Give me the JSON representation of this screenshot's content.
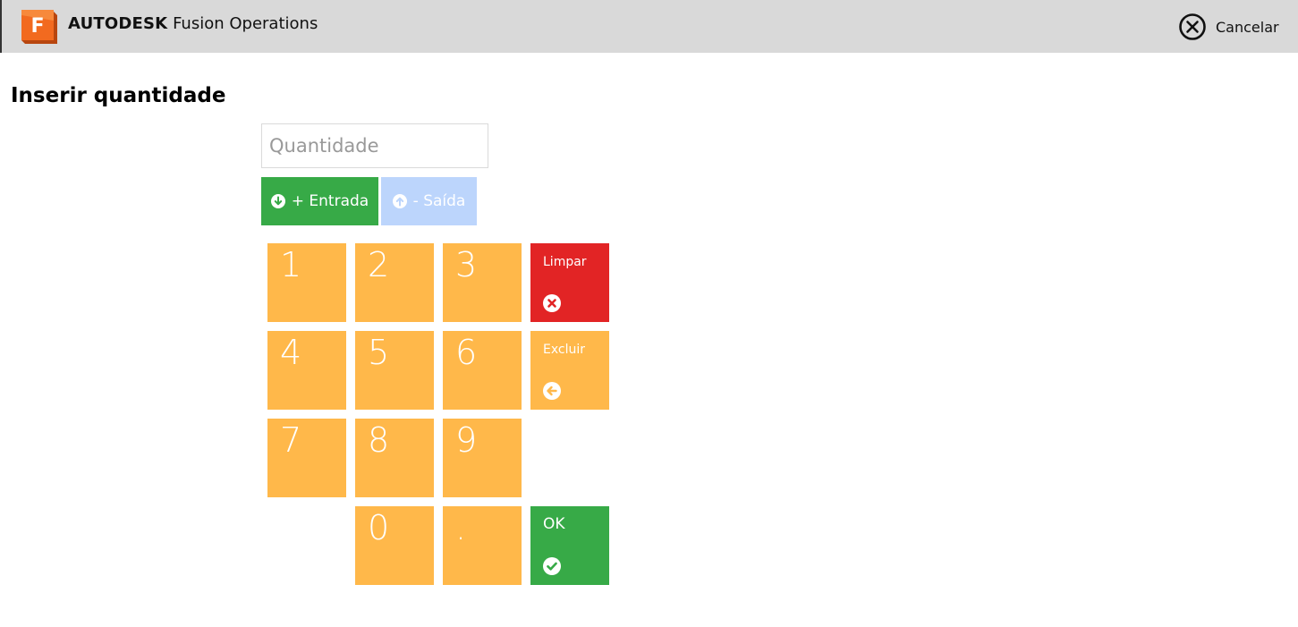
{
  "app": {
    "brand_primary": "AUTODESK",
    "brand_secondary": "Fusion Operations",
    "logo_letter": "F"
  },
  "header": {
    "cancel_label": "Cancelar"
  },
  "page": {
    "title": "Inserir quantidade"
  },
  "quantity_input": {
    "value": "",
    "placeholder": "Quantidade"
  },
  "direction": {
    "entrada_label": "+ Entrada",
    "saida_label": "- Saída"
  },
  "keypad": {
    "k1": "1",
    "k2": "2",
    "k3": "3",
    "k4": "4",
    "k5": "5",
    "k6": "6",
    "k7": "7",
    "k8": "8",
    "k9": "9",
    "k0": "0",
    "kdot": ".",
    "clear_label": "Limpar",
    "delete_label": "Excluir",
    "ok_label": "OK"
  },
  "colors": {
    "topbar": "#d9d9d9",
    "key": "#ffb84a",
    "green": "#37aa47",
    "red": "#e22425",
    "disabled_blue": "#bcd5fc"
  },
  "icons": {
    "cancel": "close-circle-icon",
    "entrada": "arrow-down-circle-icon",
    "saida": "arrow-up-circle-icon",
    "clear": "times-circle-icon",
    "delete": "arrow-left-circle-icon",
    "ok": "check-circle-icon"
  }
}
